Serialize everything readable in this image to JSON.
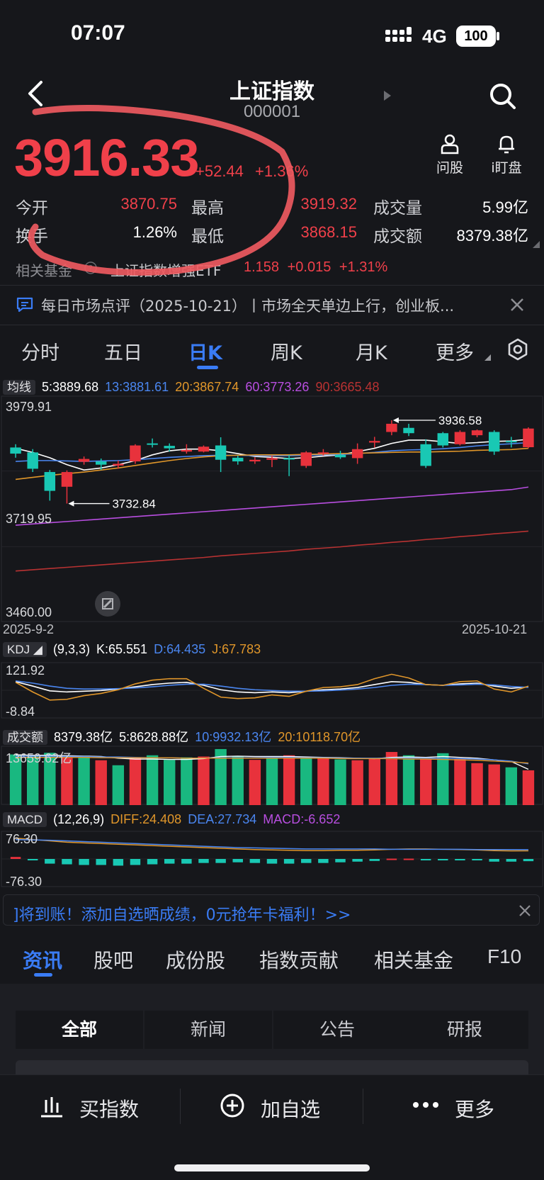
{
  "status": {
    "time": "07:07",
    "network": "4G",
    "battery": "100"
  },
  "header": {
    "title": "上证指数",
    "code": "000001"
  },
  "quote": {
    "price": "3916.33",
    "change": "+52.44",
    "change_pct": "+1.36%",
    "stats": [
      {
        "label": "今开",
        "value": "3870.75",
        "color": "#f0404a"
      },
      {
        "label": "最高",
        "value": "3919.32",
        "color": "#f0404a"
      },
      {
        "label": "成交量",
        "value": "5.99亿",
        "color": "#ffffff"
      },
      {
        "label": "换手",
        "value": "1.26%",
        "color": "#ffffff"
      },
      {
        "label": "最低",
        "value": "3868.15",
        "color": "#f0404a"
      },
      {
        "label": "成交额",
        "value": "8379.38亿",
        "color": "#ffffff"
      }
    ]
  },
  "actions": {
    "ask": "问股",
    "watch": "i盯盘"
  },
  "fund": {
    "label": "相关基金",
    "name": "上证指数增强ETF",
    "price": "1.158",
    "change": "+0.015",
    "pct": "+1.31%"
  },
  "news_ticker": "每日市场点评（2025-10-21）丨市场全天单边上行，创业板...",
  "period_tabs": [
    "分时",
    "五日",
    "日K",
    "周K",
    "月K",
    "更多"
  ],
  "period_active": "日K",
  "ma": {
    "tag": "均线",
    "items": [
      {
        "label": "5:3889.68",
        "color": "#ffffff"
      },
      {
        "label": "13:3881.61",
        "color": "#4a86f0"
      },
      {
        "label": "20:3867.74",
        "color": "#e0962a"
      },
      {
        "label": "60:3773.26",
        "color": "#b84ee0"
      },
      {
        "label": "90:3665.48",
        "color": "#b83232"
      }
    ]
  },
  "chart_data": [
    {
      "type": "candlestick",
      "y_top_label": "3979.91",
      "y_mid_label": "3719.95",
      "y_bottom_label": "3460.00",
      "ylim": [
        3460.0,
        3979.91
      ],
      "x_start": "2025-9-2",
      "x_end": "2025-10-21",
      "high_marker": "3936.58",
      "low_marker": "3732.84",
      "colors": {
        "up": "#e8323c",
        "down": "#19c8b4"
      },
      "candles": [
        {
          "o": 3870,
          "c": 3855,
          "h": 3878,
          "l": 3845
        },
        {
          "o": 3858,
          "c": 3818,
          "h": 3866,
          "l": 3810
        },
        {
          "o": 3810,
          "c": 3764,
          "h": 3815,
          "l": 3740
        },
        {
          "o": 3774,
          "c": 3810,
          "h": 3814,
          "l": 3732.84
        },
        {
          "o": 3835,
          "c": 3842,
          "h": 3848,
          "l": 3828
        },
        {
          "o": 3836,
          "c": 3828,
          "h": 3843,
          "l": 3815
        },
        {
          "o": 3826,
          "c": 3830,
          "h": 3838,
          "l": 3818
        },
        {
          "o": 3836,
          "c": 3875,
          "h": 3878,
          "l": 3830
        },
        {
          "o": 3880,
          "c": 3878,
          "h": 3892,
          "l": 3870
        },
        {
          "o": 3874,
          "c": 3868,
          "h": 3880,
          "l": 3860
        },
        {
          "o": 3860,
          "c": 3864,
          "h": 3878,
          "l": 3855
        },
        {
          "o": 3860,
          "c": 3872,
          "h": 3875,
          "l": 3858
        },
        {
          "o": 3875,
          "c": 3840,
          "h": 3895,
          "l": 3810
        },
        {
          "o": 3845,
          "c": 3836,
          "h": 3850,
          "l": 3828
        },
        {
          "o": 3836,
          "c": 3840,
          "h": 3846,
          "l": 3830
        },
        {
          "o": 3840,
          "c": 3844,
          "h": 3850,
          "l": 3822
        },
        {
          "o": 3844,
          "c": 3842,
          "h": 3852,
          "l": 3800
        },
        {
          "o": 3825,
          "c": 3858,
          "h": 3861,
          "l": 3820
        },
        {
          "o": 3856,
          "c": 3858,
          "h": 3866,
          "l": 3850
        },
        {
          "o": 3852,
          "c": 3846,
          "h": 3862,
          "l": 3842
        },
        {
          "o": 3844,
          "c": 3866,
          "h": 3880,
          "l": 3830
        },
        {
          "o": 3882,
          "c": 3886,
          "h": 3896,
          "l": 3870
        },
        {
          "o": 3908,
          "c": 3928,
          "h": 3936.58,
          "l": 3900
        },
        {
          "o": 3918,
          "c": 3905,
          "h": 3928,
          "l": 3898
        },
        {
          "o": 3878,
          "c": 3825,
          "h": 3890,
          "l": 3820
        },
        {
          "o": 3905,
          "c": 3875,
          "h": 3908,
          "l": 3870
        },
        {
          "o": 3878,
          "c": 3908,
          "h": 3912,
          "l": 3875
        },
        {
          "o": 3900,
          "c": 3912,
          "h": 3914,
          "l": 3895
        },
        {
          "o": 3908,
          "c": 3860,
          "h": 3912,
          "l": 3852
        },
        {
          "o": 3886,
          "c": 3884,
          "h": 3896,
          "l": 3870
        },
        {
          "o": 3870.75,
          "c": 3916.33,
          "h": 3919.32,
          "l": 3868.15
        }
      ],
      "ma_lines": [
        {
          "name": "5",
          "values": [
            3868,
            3858,
            3845,
            3828,
            3815,
            3820,
            3828,
            3838,
            3852,
            3862,
            3866,
            3866,
            3862,
            3855,
            3848,
            3846,
            3843,
            3845,
            3849,
            3852,
            3860,
            3868,
            3880,
            3888,
            3888,
            3884,
            3880,
            3882,
            3885,
            3886,
            3890
          ]
        },
        {
          "name": "13",
          "values": [
            3836,
            3838,
            3838,
            3837,
            3836,
            3837,
            3838,
            3840,
            3843,
            3846,
            3848,
            3850,
            3851,
            3851,
            3850,
            3850,
            3850,
            3851,
            3852,
            3853,
            3855,
            3858,
            3862,
            3864,
            3865,
            3867,
            3870,
            3874,
            3877,
            3879,
            3882
          ]
        },
        {
          "name": "20",
          "values": [
            3792,
            3797,
            3802,
            3806,
            3810,
            3815,
            3820,
            3826,
            3832,
            3838,
            3843,
            3847,
            3850,
            3851,
            3852,
            3852,
            3852,
            3853,
            3854,
            3855,
            3856,
            3857,
            3858,
            3859,
            3859,
            3860,
            3861,
            3863,
            3864,
            3865,
            3868
          ]
        },
        {
          "name": "60",
          "values": [
            3680,
            3683,
            3686,
            3689,
            3692,
            3695,
            3698,
            3701,
            3704,
            3707,
            3710,
            3713,
            3716,
            3719,
            3722,
            3725,
            3728,
            3731,
            3734,
            3737,
            3740,
            3743,
            3746,
            3749,
            3752,
            3755,
            3758,
            3761,
            3764,
            3767,
            3773.26
          ]
        },
        {
          "name": "90",
          "values": [
            3568,
            3571,
            3574,
            3577,
            3580,
            3583,
            3586,
            3589,
            3592,
            3595,
            3598,
            3601,
            3605,
            3608,
            3611,
            3614,
            3617,
            3621,
            3624,
            3627,
            3631,
            3634,
            3638,
            3641,
            3645,
            3648,
            3652,
            3655,
            3659,
            3662,
            3665.48
          ]
        }
      ]
    },
    {
      "type": "line",
      "name": "KDJ",
      "params": "(9,3,3)",
      "k_label": "K:65.551",
      "d_label": "D:64.435",
      "j_label": "J:67.783",
      "y_top_label": "121.92",
      "y_bottom_label": "-8.84",
      "ylim": [
        -8.84,
        121.92
      ],
      "series": [
        {
          "name": "K",
          "color": "#ffffff",
          "values": [
            80,
            68,
            55,
            52,
            54,
            56,
            60,
            66,
            72,
            76,
            78,
            70,
            58,
            52,
            50,
            52,
            50,
            54,
            58,
            60,
            64,
            72,
            80,
            78,
            72,
            70,
            74,
            76,
            68,
            62,
            65.551
          ]
        },
        {
          "name": "D",
          "color": "#4a86f0",
          "values": [
            82,
            76,
            68,
            62,
            60,
            60,
            61,
            63,
            66,
            70,
            73,
            73,
            68,
            62,
            58,
            56,
            54,
            54,
            55,
            57,
            60,
            64,
            70,
            73,
            72,
            70,
            71,
            73,
            71,
            67,
            64.435
          ]
        },
        {
          "name": "J",
          "color": "#e0962a",
          "values": [
            78,
            52,
            30,
            32,
            42,
            48,
            58,
            74,
            84,
            88,
            88,
            62,
            38,
            34,
            36,
            44,
            40,
            54,
            64,
            66,
            72,
            88,
            100,
            90,
            72,
            70,
            80,
            82,
            60,
            52,
            67.783
          ]
        }
      ]
    },
    {
      "type": "bar",
      "name": "成交额",
      "amount_label": "8379.38亿",
      "ma5_label": "5:8628.88亿",
      "ma10_label": "10:9932.13亿",
      "ma20_label": "20:10118.70亿",
      "y_top_label": "13659.62亿",
      "ylim": [
        0,
        13659.62
      ],
      "values": [
        12200,
        11800,
        12600,
        11400,
        11900,
        10800,
        9600,
        11400,
        12000,
        10900,
        11500,
        11700,
        13500,
        11800,
        10900,
        11200,
        12000,
        11600,
        11300,
        11000,
        10800,
        11200,
        12800,
        12000,
        11000,
        12500,
        11100,
        10100,
        9800,
        9100,
        8379.38
      ],
      "directions": [
        "down",
        "down",
        "down",
        "up",
        "down",
        "up",
        "down",
        "up",
        "down",
        "down",
        "down",
        "up",
        "down",
        "down",
        "up",
        "down",
        "up",
        "down",
        "up",
        "down",
        "up",
        "up",
        "up",
        "down",
        "up",
        "down",
        "up",
        "up",
        "up",
        "down",
        "up"
      ],
      "ma_lines": [
        {
          "name": "5",
          "color": "#ffffff",
          "values": [
            12100,
            12000,
            12000,
            11900,
            11800,
            11700,
            11300,
            11100,
            11100,
            11000,
            11000,
            11200,
            11700,
            11800,
            11700,
            11700,
            11700,
            11600,
            11500,
            11400,
            11300,
            11200,
            11500,
            11600,
            11500,
            11700,
            11500,
            11300,
            10900,
            10500,
            8628.88
          ]
        },
        {
          "name": "10",
          "color": "#4a86f0",
          "values": [
            11800,
            11800,
            11800,
            11700,
            11700,
            11600,
            11600,
            11500,
            11400,
            11400,
            11300,
            11300,
            11400,
            11400,
            11400,
            11500,
            11500,
            11400,
            11400,
            11300,
            11300,
            11300,
            11300,
            11300,
            11300,
            11300,
            11200,
            11100,
            10900,
            10600,
            9932.13
          ]
        },
        {
          "name": "20",
          "color": "#e0962a",
          "values": [
            11500,
            11500,
            11500,
            11500,
            11500,
            11400,
            11400,
            11400,
            11400,
            11400,
            11300,
            11300,
            11300,
            11300,
            11300,
            11300,
            11300,
            11300,
            11300,
            11200,
            11200,
            11200,
            11200,
            11100,
            11100,
            11000,
            10900,
            10800,
            10600,
            10400,
            10118.7
          ]
        }
      ]
    },
    {
      "type": "bar",
      "name": "MACD",
      "params": "(12,26,9)",
      "diff_label": "DIFF:24.408",
      "dea_label": "DEA:27.734",
      "macd_label": "MACD:-6.652",
      "y_top_label": "76.30",
      "y_bottom_label": "-76.30",
      "ylim": [
        -76.3,
        76.3
      ],
      "values": [
        6,
        -2,
        -14,
        -16,
        -18,
        -18,
        -20,
        -18,
        -16,
        -14,
        -14,
        -12,
        -12,
        -10,
        -12,
        -14,
        -14,
        -12,
        -12,
        -10,
        -8,
        -6,
        1,
        1,
        -1,
        -2,
        -4,
        -4,
        -8,
        -8,
        -6.652
      ],
      "series": [
        {
          "name": "DIFF",
          "color": "#e0962a",
          "values": [
            62,
            58,
            54,
            50,
            48,
            46,
            44,
            42,
            40,
            38,
            36,
            34,
            32,
            30,
            28,
            27,
            26,
            25,
            25,
            26,
            26,
            27,
            29,
            30,
            30,
            29,
            28,
            27,
            25,
            24,
            24.408
          ]
        },
        {
          "name": "DEA",
          "color": "#4a86f0",
          "values": [
            58,
            57,
            56,
            54,
            52,
            50,
            48,
            46,
            44,
            42,
            40,
            38,
            36,
            34,
            33,
            32,
            31,
            30,
            30,
            30,
            30,
            30,
            29,
            29,
            29,
            29,
            29,
            28,
            28,
            28,
            27.734
          ]
        }
      ]
    }
  ],
  "promo": {
    "text": "]将到账！添加自选晒成绩，0元抢年卡福利！>>"
  },
  "bottom_tabs": [
    "资讯",
    "股吧",
    "成份股",
    "指数贡献",
    "相关基金",
    "F10"
  ],
  "bottom_active": "资讯",
  "news_segments": [
    "全部",
    "新闻",
    "公告",
    "研报"
  ],
  "news_active": "全部",
  "footer": {
    "buy": "买指数",
    "add": "加自选",
    "more": "更多"
  }
}
